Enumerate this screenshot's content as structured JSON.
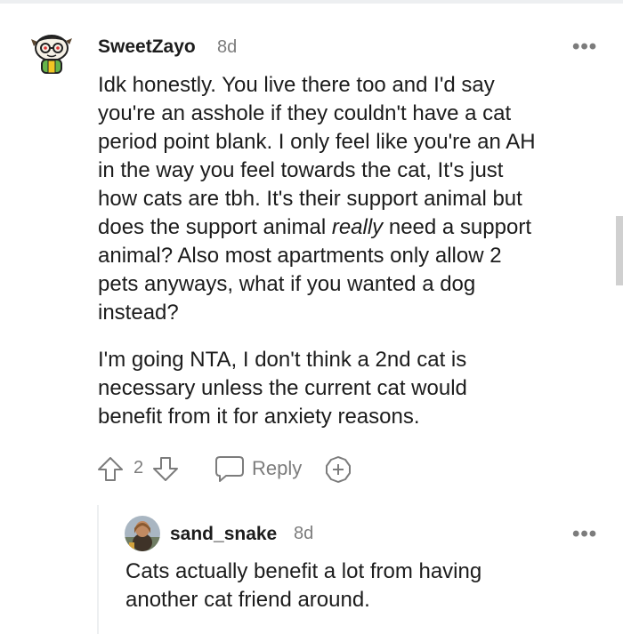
{
  "comment": {
    "author": "SweetZayo",
    "age": "8d",
    "paragraph1_lines": [
      "Idk honestly. You live there too and I'd say",
      "you're an asshole if they couldn't have a cat",
      "period point blank. I only feel like you're an AH",
      "in the way you feel towards the cat, It's just",
      "how cats are tbh. It's their support animal but",
      "animal? Also most apartments only allow 2",
      "pets anyways, what if you wanted a dog",
      "instead?"
    ],
    "line6_start": "does the support animal ",
    "line6_emphasis": "really",
    "line6_end": " need a support",
    "paragraph2_lines": [
      "I'm going NTA, I don't think a 2nd cat is",
      "necessary unless the current cat would",
      "benefit from it for anxiety reasons."
    ],
    "votes": "2",
    "reply_label": "Reply",
    "more_label": "•••"
  },
  "reply": {
    "author": "sand_snake",
    "age": "8d",
    "lines": [
      "Cats actually benefit a lot from having",
      "another cat friend around."
    ],
    "more_label": "•••"
  },
  "colors": {
    "text": "#1c1c1c",
    "meta": "#7c7c7c",
    "divider": "#edeff1"
  }
}
